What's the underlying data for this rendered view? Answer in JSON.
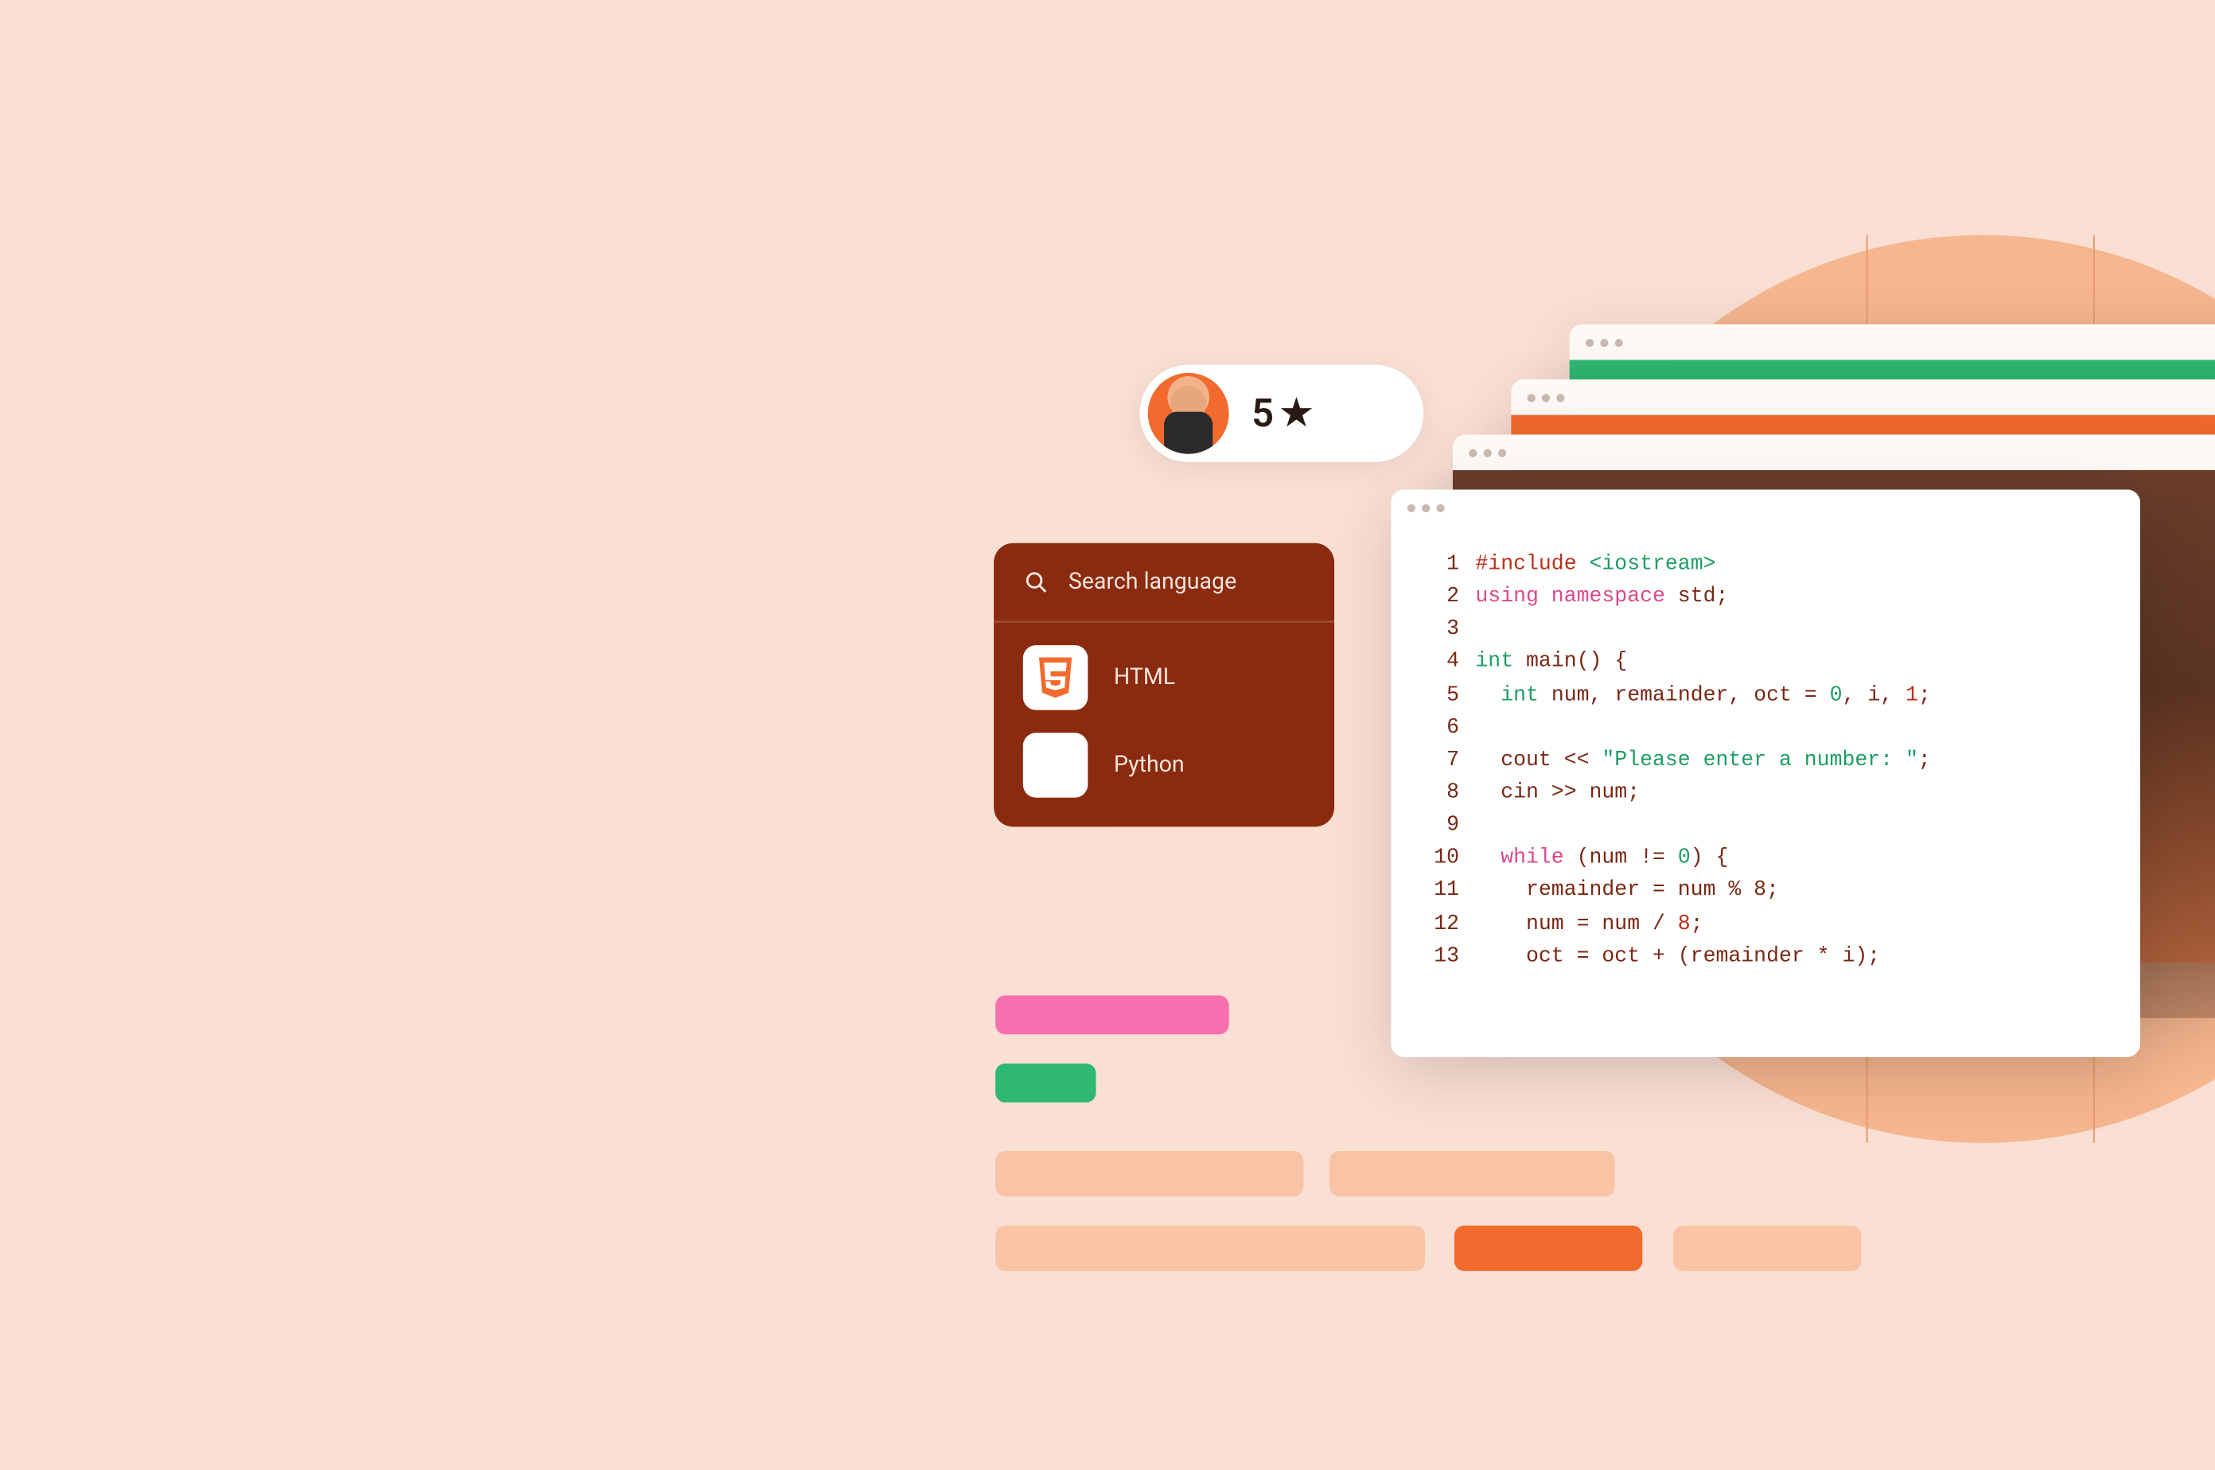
{
  "rating": {
    "score": "5",
    "star_icon": "star-icon"
  },
  "search": {
    "placeholder": "Search language",
    "items": [
      {
        "label": "HTML",
        "icon": "html5-icon"
      },
      {
        "label": "Python",
        "icon": "blank-icon"
      }
    ]
  },
  "code": {
    "lines": [
      {
        "n": "1",
        "tokens": [
          {
            "t": "#include ",
            "c": "c-red"
          },
          {
            "t": "<iostream>",
            "c": "c-green"
          }
        ]
      },
      {
        "n": "2",
        "tokens": [
          {
            "t": "using namespace ",
            "c": "c-pink"
          },
          {
            "t": "std;",
            "c": "c-darkred"
          }
        ]
      },
      {
        "n": "3",
        "tokens": [
          {
            "t": "",
            "c": ""
          }
        ]
      },
      {
        "n": "4",
        "tokens": [
          {
            "t": "int ",
            "c": "c-teal"
          },
          {
            "t": "main() {",
            "c": "c-darkred"
          }
        ]
      },
      {
        "n": "5",
        "tokens": [
          {
            "t": "  ",
            "c": ""
          },
          {
            "t": "int ",
            "c": "c-teal"
          },
          {
            "t": "num, remainder, oct = ",
            "c": "c-darkred"
          },
          {
            "t": "0",
            "c": "c-green"
          },
          {
            "t": ", i, ",
            "c": "c-darkred"
          },
          {
            "t": "1",
            "c": "c-red"
          },
          {
            "t": ";",
            "c": "c-darkred"
          }
        ]
      },
      {
        "n": "6",
        "tokens": [
          {
            "t": "",
            "c": ""
          }
        ]
      },
      {
        "n": "7",
        "tokens": [
          {
            "t": "  cout << ",
            "c": "c-darkred"
          },
          {
            "t": "\"Please enter a number: \"",
            "c": "c-green"
          },
          {
            "t": ";",
            "c": "c-darkred"
          }
        ]
      },
      {
        "n": "8",
        "tokens": [
          {
            "t": "  cin >> num;",
            "c": "c-darkred"
          }
        ]
      },
      {
        "n": "9",
        "tokens": [
          {
            "t": "",
            "c": ""
          }
        ]
      },
      {
        "n": "10",
        "tokens": [
          {
            "t": "  ",
            "c": ""
          },
          {
            "t": "while ",
            "c": "c-pink"
          },
          {
            "t": "(num != ",
            "c": "c-darkred"
          },
          {
            "t": "0",
            "c": "c-green"
          },
          {
            "t": ") {",
            "c": "c-darkred"
          }
        ]
      },
      {
        "n": "11",
        "tokens": [
          {
            "t": "    remainder = num % 8;",
            "c": "c-darkred"
          }
        ]
      },
      {
        "n": "12",
        "tokens": [
          {
            "t": "    num = num / ",
            "c": "c-darkred"
          },
          {
            "t": "8",
            "c": "c-red"
          },
          {
            "t": ";",
            "c": "c-darkred"
          }
        ]
      },
      {
        "n": "13",
        "tokens": [
          {
            "t": "    oct = oct + (remainder * i);",
            "c": "c-darkred"
          }
        ]
      }
    ]
  }
}
